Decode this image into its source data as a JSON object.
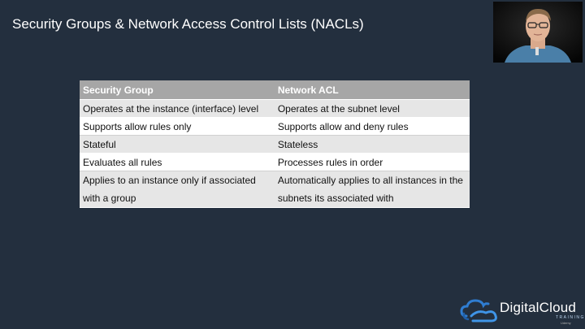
{
  "slide": {
    "title": "Security Groups & Network Access Control Lists (NACLs)"
  },
  "table": {
    "headers": [
      "Security Group",
      "Network ACL"
    ],
    "rows": [
      [
        "Operates at the instance (interface) level",
        "Operates at the subnet level"
      ],
      [
        "Supports allow rules only",
        "Supports allow and deny rules"
      ],
      [
        "Stateful",
        "Stateless"
      ],
      [
        "Evaluates all rules",
        "Processes rules in order"
      ],
      [
        "Applies to an instance only if associated with a group",
        "Automatically applies to all instances in the subnets its associated with"
      ]
    ]
  },
  "logo": {
    "name": "DigitalCloud",
    "sub": "TRAINING",
    "platform": "Udemy"
  },
  "colors": {
    "background": "#232f3e",
    "table_header": "#a6a6a6",
    "row_shaded": "#e6e6e6",
    "logo_blue": "#2f7dd1"
  }
}
